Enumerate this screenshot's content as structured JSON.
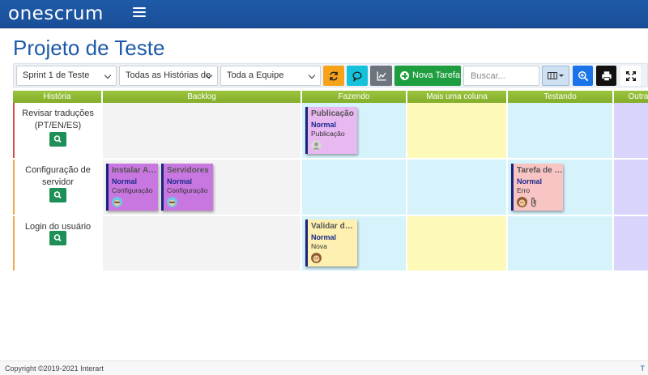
{
  "app": {
    "brand": "onescrum"
  },
  "page": {
    "title": "Projeto de Teste"
  },
  "toolbar": {
    "sprint_select": "Sprint 1 de Teste",
    "stories_select": "Todas as Histórias de",
    "team_select": "Toda a Equipe",
    "new_task_label": "Nova Tarefa",
    "search_placeholder": "Buscar..."
  },
  "board": {
    "columns": [
      {
        "label": "História"
      },
      {
        "label": "Backlog"
      },
      {
        "label": "Fazendo"
      },
      {
        "label": "Mais uma coluna"
      },
      {
        "label": "Testando"
      },
      {
        "label": "Outra"
      }
    ],
    "stories": [
      {
        "title": "Revisar traduções (PT/EN/ES)",
        "cards": [
          {
            "title": "Publicação",
            "priority": "Normal",
            "type": "Publicação",
            "column": "Fazendo"
          }
        ]
      },
      {
        "title": "Configuração de servidor",
        "cards": [
          {
            "title": "Instalar Ap...",
            "priority": "Normal",
            "type": "Configuração",
            "column": "Backlog"
          },
          {
            "title": "Servidores",
            "priority": "Normal",
            "type": "Configuração",
            "column": "Backlog"
          },
          {
            "title": "Tarefa de T...",
            "priority": "Normal",
            "type": "Erro",
            "column": "Testando"
          }
        ]
      },
      {
        "title": "Login do usuário",
        "cards": [
          {
            "title": "Validar dad...",
            "priority": "Normal",
            "type": "Nova",
            "column": "Fazendo"
          }
        ]
      }
    ]
  },
  "colors": {
    "navbar": "#1e5aa8",
    "column_header": "#8db832",
    "fazendo_bg": "#d6f3fb",
    "mais_uma_coluna_bg": "#fdf9b8",
    "outra_bg": "#d9d4fb",
    "card_publicacao": "#e8b8f0",
    "card_config": "#c977e0",
    "card_erro": "#f9c4c4",
    "card_nova": "#fdf0b0",
    "story_bar_red": "#d94b4b",
    "story_bar_orange": "#f0a848"
  },
  "footer": {
    "copyright": "Copyright ©2019-2021 Interart",
    "right_text": "T"
  }
}
